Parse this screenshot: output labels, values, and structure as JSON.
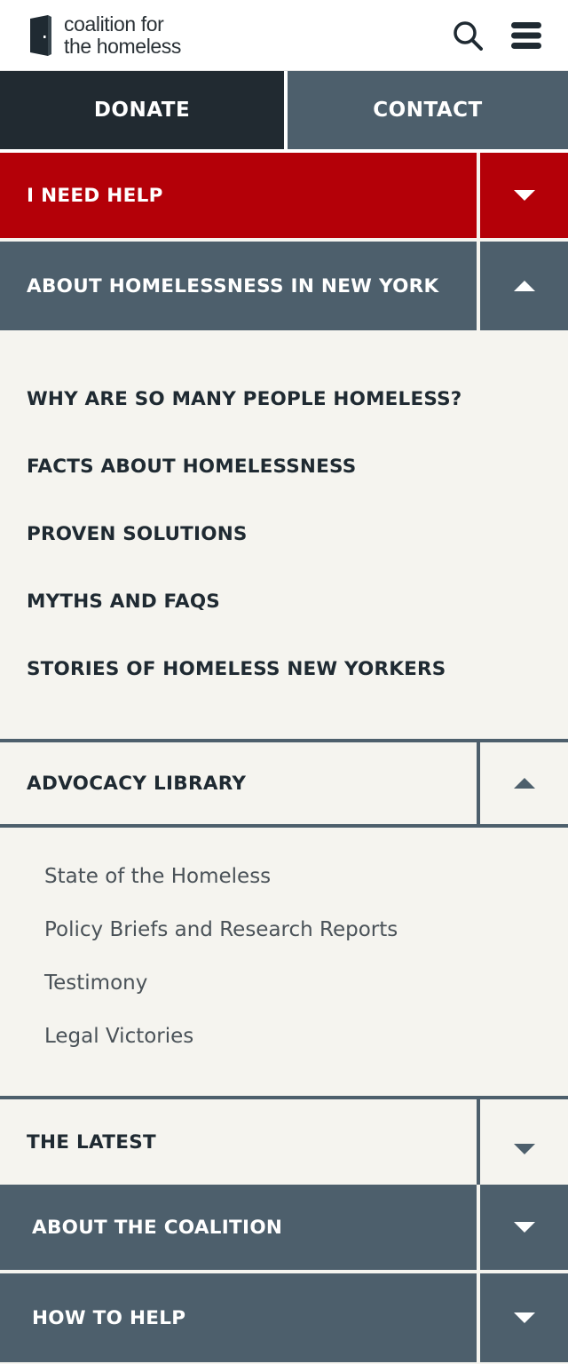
{
  "header": {
    "logo_line1": "coalition for",
    "logo_line2": "the homeless",
    "logo_icon": "door-icon",
    "search_icon": "search-icon",
    "menu_icon": "hamburger-menu-icon"
  },
  "top_buttons": {
    "donate": "DONATE",
    "contact": "CONTACT"
  },
  "nav": {
    "i_need_help": "I NEED HELP",
    "about_homelessness": "ABOUT HOMELESSNESS IN NEW YORK",
    "about_homelessness_items": [
      "WHY ARE SO MANY PEOPLE HOMELESS?",
      "FACTS ABOUT HOMELESSNESS",
      "PROVEN SOLUTIONS",
      "MYTHS AND FAQS",
      "STORIES OF HOMELESS NEW YORKERS"
    ],
    "advocacy_library": "ADVOCACY LIBRARY",
    "advocacy_library_items": [
      "State of the Homeless",
      "Policy Briefs and Research Reports",
      "Testimony",
      "Legal Victories"
    ],
    "the_latest": "THE LATEST",
    "about_coalition": "ABOUT THE COALITION",
    "how_to_help": "HOW TO HELP"
  },
  "colors": {
    "red": "#b40008",
    "slate": "#4d5f6c",
    "dark": "#212a31",
    "background": "#f5f4ef"
  }
}
